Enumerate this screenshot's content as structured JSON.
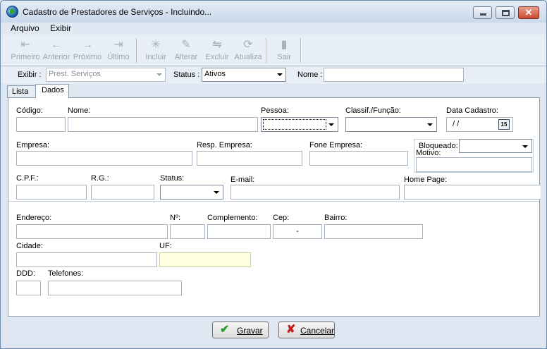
{
  "window": {
    "title": "Cadastro de Prestadores de Serviços - Incluindo...",
    "controls": {
      "minimize": "",
      "maximize": "",
      "close": "✕"
    }
  },
  "menu": {
    "items": [
      "Arquivo",
      "Exibir"
    ]
  },
  "toolbar": {
    "buttons": [
      "Primeiro",
      "Anterior",
      "Próximo",
      "Último",
      "Incluir",
      "Alterar",
      "Excluir",
      "Atualiza",
      "Sair"
    ],
    "icons": [
      "first-record-icon",
      "previous-arrow-icon",
      "next-arrow-icon",
      "last-record-icon",
      "new-record-icon",
      "edit-record-icon",
      "delete-record-icon",
      "refresh-icon",
      "exit-door-icon"
    ]
  },
  "filter": {
    "exibir_label": "Exibir :",
    "exibir_value": "Prest. Serviços",
    "status_label": "Status :",
    "status_value": "Ativos",
    "nome_label": "Nome :",
    "nome_value": ""
  },
  "tabs": [
    "Lista",
    "Dados"
  ],
  "form": {
    "codigo_label": "Código:",
    "nome_label": "Nome:",
    "pessoa_label": "Pessoa:",
    "classif_label": "Classif./Função:",
    "data_cadastro_label": "Data Cadastro:",
    "data_cadastro_value": "/ /",
    "calendar_label": "15",
    "empresa_label": "Empresa:",
    "resp_empresa_label": "Resp. Empresa:",
    "fone_empresa_label": "Fone Empresa:",
    "bloqueado_label": "Bloqueado:",
    "motivo_label": "Motivo:",
    "cpf_label": "C.P.F.:",
    "rg_label": "R.G.:",
    "status_label": "Status:",
    "email_label": "E-mail:",
    "home_page_label": "Home Page:",
    "endereco_label": "Endereço:",
    "numero_label": "Nº:",
    "complemento_label": "Complemento:",
    "cep_label": "Cep:",
    "cep_value": "-",
    "bairro_label": "Bairro:",
    "cidade_label": "Cidade:",
    "uf_label": "UF:",
    "ddd_label": "DDD:",
    "telefones_label": "Telefones:"
  },
  "footer": {
    "gravar_label": "Gravar",
    "gravar_icon": "✔",
    "cancelar_label": "Cancelar",
    "cancelar_icon": "✘"
  },
  "colors": {
    "gravar_icon": "#2f9a2f",
    "cancelar_icon": "#c32020",
    "uf_field": "#ffffe1"
  }
}
